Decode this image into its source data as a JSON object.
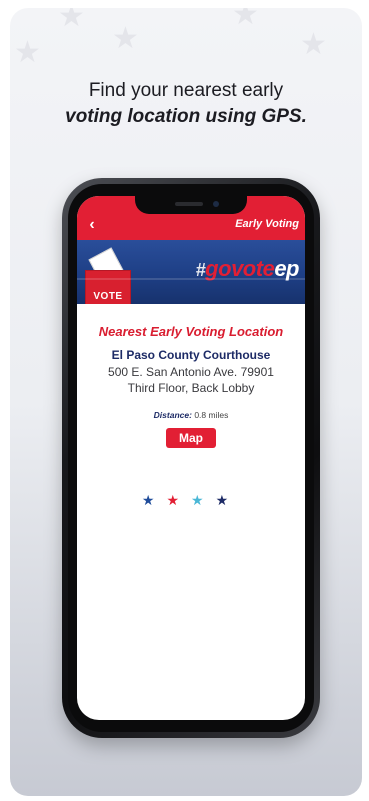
{
  "headline": {
    "line1": "Find your nearest early",
    "line2": "voting location using GPS."
  },
  "app": {
    "topbar": {
      "back_glyph": "‹",
      "title": "Early Voting"
    },
    "banner": {
      "vote_label": "VOTE",
      "brand_hash": "#",
      "brand_go": "go",
      "brand_vote": "vote",
      "brand_ep": "ep"
    },
    "section_title": "Nearest Early Voting Location",
    "location": {
      "name": "El Paso County Courthouse",
      "address_line1": "500 E. San Antonio Ave. 79901",
      "address_line2": "Third Floor, Back Lobby"
    },
    "distance": {
      "label": "Distance:",
      "value": "0.8 miles"
    },
    "map_button": "Map",
    "page_dots": [
      "★",
      "★",
      "★",
      "★"
    ]
  },
  "colors": {
    "accent_red": "#e21f34",
    "navy": "#1d2b66",
    "banner_blue": "#1e3f85",
    "dot_colors": [
      "#1f4c9a",
      "#e21f34",
      "#4ab7d6",
      "#1d2b66"
    ]
  },
  "icons": {
    "back": "chevron-left-icon",
    "ballot": "ballot-box-icon",
    "star": "star-icon"
  }
}
